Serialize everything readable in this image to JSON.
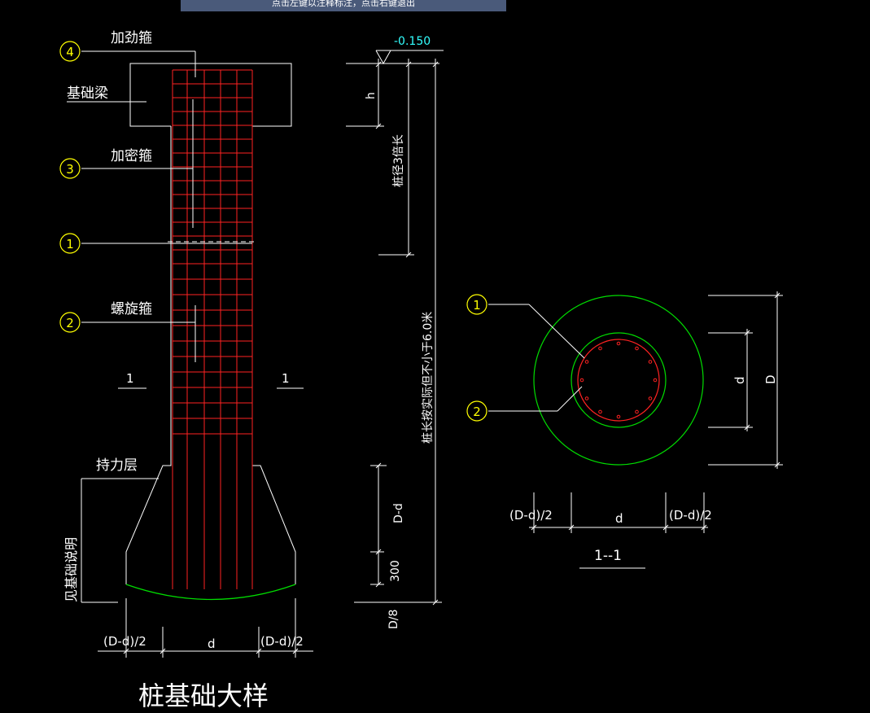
{
  "tooltip": "点击左键以注释标注，点击右键退出",
  "colors": {
    "background": "#000000",
    "outline": "#ffffff",
    "rebar": "#ff2020",
    "ground": "#00dd00",
    "callout": "#ffff00",
    "elevation": "#33ffff"
  },
  "callouts": {
    "c1": "1",
    "c2": "2",
    "c3": "3",
    "c4": "4"
  },
  "elevation": "-0.150",
  "labels": {
    "stiffener": "加劲箍",
    "foundation_beam": "基础梁",
    "dense_stirrup": "加密箍",
    "spiral_stirrup": "螺旋箍",
    "bearing_layer": "持力层",
    "see_notes": "见基础说明",
    "section_mark": "1",
    "h": "h",
    "three_d": "桩径3倍长",
    "pile_length": "桩长按实际但不小于6.0米",
    "D_minus_d": "D-d",
    "three_hundred": "300",
    "D_over_8": "D/8",
    "half_diff": "(D-d)/2",
    "d": "d",
    "D": "D",
    "section_title": "1--1",
    "drawing_title": "桩基础大样"
  }
}
